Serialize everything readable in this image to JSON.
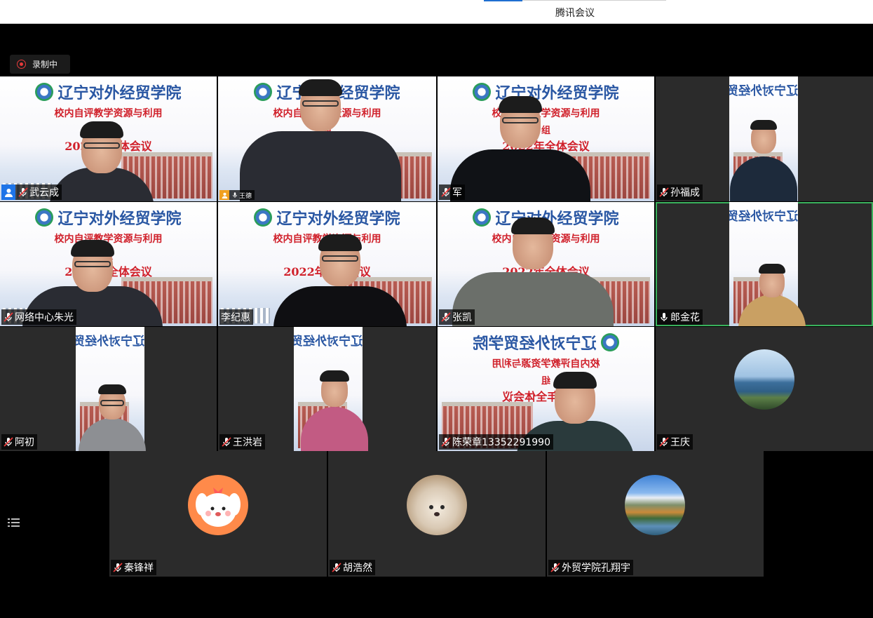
{
  "window": {
    "title": "腾讯会议"
  },
  "recording": {
    "label": "录制中",
    "color": "#e83a3a"
  },
  "slide": {
    "brand": "辽宁对外经贸学院",
    "line1": "校内自评教学资源与利用",
    "line2": "组",
    "line3": "2022年全体会议"
  },
  "participants": [
    {
      "name": "武云成",
      "host": true,
      "mic": "muted"
    },
    {
      "name": "王德",
      "host": true,
      "mic": "on"
    },
    {
      "name": "军",
      "mic": "muted"
    },
    {
      "name": "孙福成",
      "mic": "muted"
    },
    {
      "name": "网络中心朱光",
      "mic": "muted"
    },
    {
      "name": "李纪惠",
      "mic": "none"
    },
    {
      "name": "张凯",
      "mic": "muted"
    },
    {
      "name": "郎金花",
      "mic": "on",
      "speaking": true
    },
    {
      "name": "阿初",
      "mic": "muted"
    },
    {
      "name": "王洪岩",
      "mic": "muted"
    },
    {
      "name": "陈荣章13352291990",
      "mic": "muted"
    },
    {
      "name": "王庆",
      "mic": "muted"
    },
    {
      "name": "秦锋祥",
      "mic": "muted"
    },
    {
      "name": "胡浩然",
      "mic": "muted"
    },
    {
      "name": "外贸学院孔翔宇",
      "mic": "muted"
    }
  ],
  "colors": {
    "host_badge": "#1e74e8",
    "speaking_border": "#3ab15c",
    "tile_bg": "#2b2b2b"
  },
  "icons": {
    "menu": "list-menu-icon",
    "mic_muted": "mic-muted-icon",
    "mic_on": "mic-icon",
    "host": "host-user-icon"
  }
}
